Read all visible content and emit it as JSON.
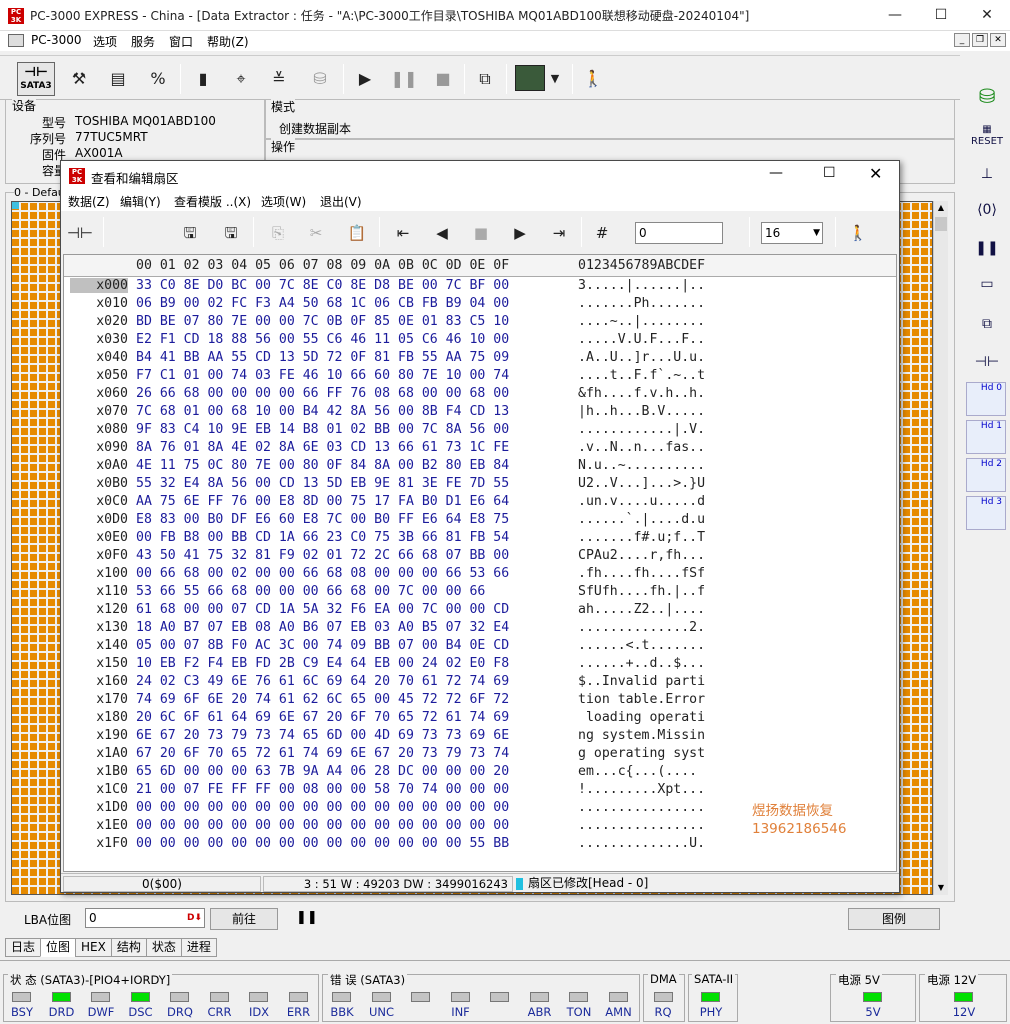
{
  "window": {
    "title": "PC-3000 EXPRESS - China - [Data Extractor : 任务 - \"A:\\PC-3000工作目录\\TOSHIBA MQ01ABD100联想移动硬盘-20240104\"]",
    "minimize": "—",
    "maximize": "☐",
    "close": "✕"
  },
  "menu": [
    "PC-3000",
    "选项",
    "服务",
    "窗口",
    "帮助(Z)"
  ],
  "toolbar": {
    "sata3_label": "SATA3"
  },
  "device": {
    "group_label": "设备",
    "model_label": "型号",
    "model": "TOSHIBA MQ01ABD100",
    "serial_label": "序列号",
    "serial": "77TUC5MRT",
    "firmware_label": "固件",
    "firmware": "AX001A",
    "capacity_label": "容量"
  },
  "mode": {
    "label": "模式",
    "value": "创建数据副本"
  },
  "operation": {
    "label": "操作"
  },
  "grid_label": "0 - Defau",
  "dialog": {
    "title": "查看和编辑扇区",
    "menu": [
      "数据(Z)",
      "编辑(Y)",
      "查看模版 ..(X)",
      "选项(W)",
      "退出(V)"
    ],
    "offset_input": "0",
    "columns_select": "16",
    "hex_header_offsets": "00 01 02 03 04 05 06 07 08 09 0A 0B 0C 0D 0E 0F",
    "ascii_header": "0123456789ABCDEF",
    "rows": [
      {
        "off": "x000",
        "hex": "33 C0 8E D0 BC 00 7C 8E C0 8E D8 BE 00 7C BF 00",
        "asc": "3.....|......|.."
      },
      {
        "off": "x010",
        "hex": "06 B9 00 02 FC F3 A4 50 68 1C 06 CB FB B9 04 00",
        "asc": ".......Ph......."
      },
      {
        "off": "x020",
        "hex": "BD BE 07 80 7E 00 00 7C 0B 0F 85 0E 01 83 C5 10",
        "asc": "....~..|........"
      },
      {
        "off": "x030",
        "hex": "E2 F1 CD 18 88 56 00 55 C6 46 11 05 C6 46 10 00",
        "asc": ".....V.U.F...F.."
      },
      {
        "off": "x040",
        "hex": "B4 41 BB AA 55 CD 13 5D 72 0F 81 FB 55 AA 75 09",
        "asc": ".A..U..]r...U.u."
      },
      {
        "off": "x050",
        "hex": "F7 C1 01 00 74 03 FE 46 10 66 60 80 7E 10 00 74",
        "asc": "....t..F.f`.~..t"
      },
      {
        "off": "x060",
        "hex": "26 66 68 00 00 00 00 66 FF 76 08 68 00 00 68 00",
        "asc": "&fh....f.v.h..h."
      },
      {
        "off": "x070",
        "hex": "7C 68 01 00 68 10 00 B4 42 8A 56 00 8B F4 CD 13",
        "asc": "|h..h...B.V....."
      },
      {
        "off": "x080",
        "hex": "9F 83 C4 10 9E EB 14 B8 01 02 BB 00 7C 8A 56 00",
        "asc": "............|.V."
      },
      {
        "off": "x090",
        "hex": "8A 76 01 8A 4E 02 8A 6E 03 CD 13 66 61 73 1C FE",
        "asc": ".v..N..n...fas.."
      },
      {
        "off": "x0A0",
        "hex": "4E 11 75 0C 80 7E 00 80 0F 84 8A 00 B2 80 EB 84",
        "asc": "N.u..~.........."
      },
      {
        "off": "x0B0",
        "hex": "55 32 E4 8A 56 00 CD 13 5D EB 9E 81 3E FE 7D 55",
        "asc": "U2..V...]...>.}U"
      },
      {
        "off": "x0C0",
        "hex": "AA 75 6E FF 76 00 E8 8D 00 75 17 FA B0 D1 E6 64",
        "asc": ".un.v....u.....d"
      },
      {
        "off": "x0D0",
        "hex": "E8 83 00 B0 DF E6 60 E8 7C 00 B0 FF E6 64 E8 75",
        "asc": "......`.|....d.u"
      },
      {
        "off": "x0E0",
        "hex": "00 FB B8 00 BB CD 1A 66 23 C0 75 3B 66 81 FB 54",
        "asc": ".......f#.u;f..T"
      },
      {
        "off": "x0F0",
        "hex": "43 50 41 75 32 81 F9 02 01 72 2C 66 68 07 BB 00",
        "asc": "CPAu2....r,fh..."
      },
      {
        "off": "x100",
        "hex": "00 66 68 00 02 00 00 66 68 08 00 00 00 66 53 66",
        "asc": ".fh....fh....fSf"
      },
      {
        "off": "x110",
        "hex": "53 66 55 66 68 00 00 00 66 68 00 7C 00 00 66",
        "asc": "SfUfh....fh.|..f"
      },
      {
        "off": "x120",
        "hex": "61 68 00 00 07 CD 1A 5A 32 F6 EA 00 7C 00 00 CD",
        "asc": "ah.....Z2..|...."
      },
      {
        "off": "x130",
        "hex": "18 A0 B7 07 EB 08 A0 B6 07 EB 03 A0 B5 07 32 E4",
        "asc": "..............2."
      },
      {
        "off": "x140",
        "hex": "05 00 07 8B F0 AC 3C 00 74 09 BB 07 00 B4 0E CD",
        "asc": "......<.t......."
      },
      {
        "off": "x150",
        "hex": "10 EB F2 F4 EB FD 2B C9 E4 64 EB 00 24 02 E0 F8",
        "asc": "......+..d..$..."
      },
      {
        "off": "x160",
        "hex": "24 02 C3 49 6E 76 61 6C 69 64 20 70 61 72 74 69",
        "asc": "$..Invalid parti"
      },
      {
        "off": "x170",
        "hex": "74 69 6F 6E 20 74 61 62 6C 65 00 45 72 72 6F 72",
        "asc": "tion table.Error"
      },
      {
        "off": "x180",
        "hex": "20 6C 6F 61 64 69 6E 67 20 6F 70 65 72 61 74 69",
        "asc": " loading operati"
      },
      {
        "off": "x190",
        "hex": "6E 67 20 73 79 73 74 65 6D 00 4D 69 73 73 69 6E",
        "asc": "ng system.Missin"
      },
      {
        "off": "x1A0",
        "hex": "67 20 6F 70 65 72 61 74 69 6E 67 20 73 79 73 74",
        "asc": "g operating syst"
      },
      {
        "off": "x1B0",
        "hex": "65 6D 00 00 00 63 7B 9A A4 06 28 DC 00 00 00 20",
        "asc": "em...c{...(...."
      },
      {
        "off": "x1C0",
        "hex": "21 00 07 FE FF FF 00 08 00 00 58 70 74 00 00 00",
        "asc": "!.........Xpt..."
      },
      {
        "off": "x1D0",
        "hex": "00 00 00 00 00 00 00 00 00 00 00 00 00 00 00 00",
        "asc": "................"
      },
      {
        "off": "x1E0",
        "hex": "00 00 00 00 00 00 00 00 00 00 00 00 00 00 00 00",
        "asc": "................"
      },
      {
        "off": "x1F0",
        "hex": "00 00 00 00 00 00 00 00 00 00 00 00 00 00 55 BB",
        "asc": "..............U."
      }
    ],
    "status_offset": "0($00)",
    "status_values": "3 : 51 W : 49203 DW : 3499016243",
    "status_modified": "扇区已修改[Head - 0]"
  },
  "watermark": {
    "line1": "煜扬数据恢复",
    "line2": "13962186546"
  },
  "lba": {
    "label": "LBA位图",
    "value": "0",
    "goto_button": "前往",
    "legend_button": "图例"
  },
  "tabs": [
    "日志",
    "位图",
    "HEX",
    "结构",
    "状态",
    "进程"
  ],
  "status_groups": {
    "state_title": "状 态 (SATA3)-[PIO4+IORDY]",
    "state_leds": [
      {
        "label": "BSY",
        "on": false
      },
      {
        "label": "DRD",
        "on": true
      },
      {
        "label": "DWF",
        "on": false
      },
      {
        "label": "DSC",
        "on": true
      },
      {
        "label": "DRQ",
        "on": false
      },
      {
        "label": "CRR",
        "on": false
      },
      {
        "label": "IDX",
        "on": false
      },
      {
        "label": "ERR",
        "on": false
      }
    ],
    "error_title": "错 误 (SATA3)",
    "error_leds": [
      {
        "label": "BBK",
        "on": false
      },
      {
        "label": "UNC",
        "on": false
      },
      {
        "label": "",
        "on": false
      },
      {
        "label": "INF",
        "on": false
      },
      {
        "label": "",
        "on": false
      },
      {
        "label": "ABR",
        "on": false
      },
      {
        "label": "TON",
        "on": false
      },
      {
        "label": "AMN",
        "on": false
      }
    ],
    "dma_title": "DMA",
    "dma_led": "RQ",
    "sata_title": "SATA-II",
    "sata_led": "PHY",
    "power5_title": "电源 5V",
    "power5_led": "5V",
    "power12_title": "电源 12V",
    "power12_led": "12V"
  },
  "right_panel": {
    "hd_labels": [
      "Hd 0",
      "Hd 1",
      "Hd 2",
      "Hd 3"
    ]
  },
  "colors": {
    "grid_block": "#e68a00",
    "led_on": "#00e000",
    "hex_text": "#1c1c9c"
  }
}
